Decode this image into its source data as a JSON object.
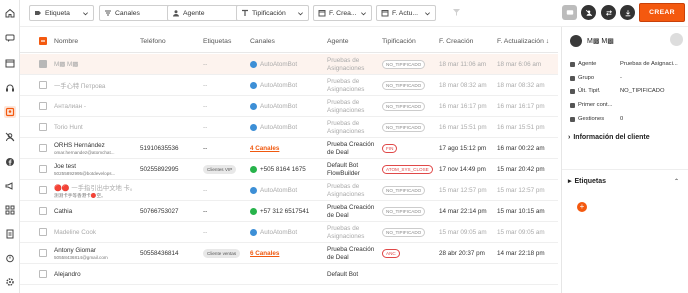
{
  "filters": {
    "etiqueta": "Etiqueta",
    "canales": "Canales",
    "agente": "Agente",
    "tipificacion": "Tipificación",
    "f_creacion": "F. Crea...",
    "f_actualizacion": "F. Actu..."
  },
  "create_button": "CREAR",
  "columns": {
    "nombre": "Nombre",
    "telefono": "Teléfono",
    "etiquetas": "Etiquetas",
    "canales": "Canales",
    "agente": "Agente",
    "tipificacion": "Tipificación",
    "f_creacion": "F. Creación",
    "f_actualizacion": "F. Actualización ↓"
  },
  "rows": [
    {
      "name": "M▩ M▩",
      "sub": "",
      "phone": "",
      "tags": "--",
      "channel": "AutoAtomBot",
      "agent": "Pruebas de Asignaciones",
      "typ": "NO_TIPIFICADO",
      "created": "18 mar 11:06 am",
      "updated": "18 mar 6:06 am"
    },
    {
      "name": "一手心特 Петрова",
      "sub": "",
      "phone": "",
      "tags": "--",
      "channel": "AutoAtomBot",
      "agent": "Pruebas de Asignaciones",
      "typ": "NO_TIPIFICADO",
      "created": "18 mar 08:32 am",
      "updated": "18 mar 08:32 am"
    },
    {
      "name": "Анталиан -",
      "sub": "",
      "phone": "",
      "tags": "--",
      "channel": "AutoAtomBot",
      "agent": "Pruebas de Asignaciones",
      "typ": "NO_TIPIFICADO",
      "created": "16 mar 16:17 pm",
      "updated": "16 mar 16:17 pm"
    },
    {
      "name": "Torio Hunt",
      "sub": "",
      "phone": "",
      "tags": "--",
      "channel": "AutoAtomBot",
      "agent": "Pruebas de Asignaciones",
      "typ": "NO_TIPIFICADO",
      "created": "16 mar 15:51 pm",
      "updated": "16 mar 15:51 pm"
    },
    {
      "name": "ORHS Hernández",
      "sub": "omar.hernandez@atomchat...",
      "phone": "51910635536",
      "tags": "--",
      "channel": "4 Canales",
      "agent": "Prueba Creación de Deal",
      "typ": "FIN",
      "created": "17 ago 15:12 pm",
      "updated": "16 mar 00:22 am"
    },
    {
      "name": "Joe test",
      "sub": "50255892995@botdevelops...",
      "phone": "50255892995",
      "tags": "Clientes VIP",
      "channel": "+505 8164 1675",
      "agent": "Default Bot FlowBuilder",
      "typ": "ATOM_SYS_CLOSE",
      "created": "17 nov 14:49 pm",
      "updated": "15 mar 20:42 pm"
    },
    {
      "name": "🔴🔴 一手指引出中文地 卡。",
      "sub": "测测卡手等香港卡🔴空。",
      "phone": "",
      "tags": "--",
      "channel": "AutoAtomBot",
      "agent": "Pruebas de Asignaciones",
      "typ": "NO_TIPIFICADO",
      "created": "15 mar 12:57 pm",
      "updated": "15 mar 12:57 pm"
    },
    {
      "name": "Cathia",
      "sub": "",
      "phone": "50766753027",
      "tags": "--",
      "channel": "+57 312 6517541",
      "agent": "Prueba Creación de Deal",
      "typ": "NO_TIPIFICADO",
      "created": "14 mar 22:14 pm",
      "updated": "15 mar 10:15 am"
    },
    {
      "name": "Madeline Cook",
      "sub": "",
      "phone": "",
      "tags": "--",
      "channel": "AutoAtomBot",
      "agent": "Pruebas de Asignaciones",
      "typ": "NO_TIPIFICADO",
      "created": "15 mar 09:05 am",
      "updated": "15 mar 09:05 am"
    },
    {
      "name": "Antony Giomar",
      "sub": "50558436814@gmail.com",
      "phone": "50558436814",
      "tags": "Cliente ventas",
      "channel": "6 Canales",
      "agent": "Prueba Creación de Deal",
      "typ": "ANC",
      "created": "28 abr 20:37 pm",
      "updated": "14 mar 22:18 pm"
    },
    {
      "name": "Alejandro",
      "sub": "",
      "phone": "",
      "tags": "",
      "channel": "",
      "agent": "Default Bot",
      "typ": "",
      "created": "",
      "updated": ""
    }
  ],
  "detail": {
    "name": "M▩ M▩",
    "fields": [
      {
        "k": "Agente",
        "v": "Pruebas de Asignaci..."
      },
      {
        "k": "Grupo",
        "v": "-"
      },
      {
        "k": "Últ. Tipif.",
        "v": "NO_TIPIFICADO"
      },
      {
        "k": "Primer cont...",
        "v": ""
      },
      {
        "k": "Gestiones",
        "v": "0"
      }
    ],
    "info_title": "Información del cliente",
    "tags_title": "Etiquetas"
  },
  "colors": {
    "accent": "#f4590f",
    "telegram": "#3d8fd6",
    "whatsapp": "#27b34b"
  }
}
